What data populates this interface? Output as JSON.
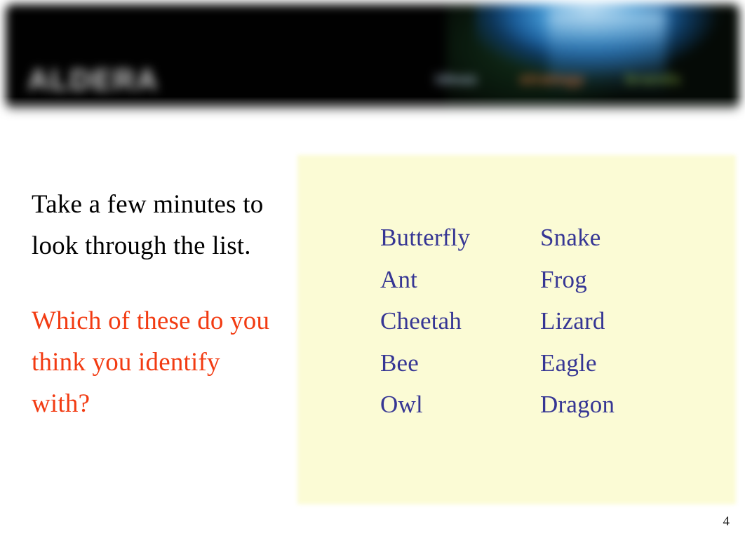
{
  "slide": {
    "page_number": "4",
    "background_color": "#ffffff"
  },
  "banner": {
    "logo_text": "ALDERA",
    "nav_words": [
      {
        "label": "ideas",
        "color": "#9fb3c6"
      },
      {
        "label": "strategy",
        "color": "#c4693c"
      },
      {
        "label": "brands",
        "color": "#6f9038"
      }
    ],
    "background_color": "#010101",
    "glow_color": "#3f93cf"
  },
  "left_column": {
    "instruction": "Take a few minutes to look through the list.",
    "instruction_color": "#000000",
    "question": "Which of these do you think you identify with?",
    "question_color": "#f23b12"
  },
  "list_panel": {
    "background_color": "#fbfbd5",
    "text_color": "#363694",
    "column_left": [
      "Butterfly",
      "Ant",
      "Cheetah",
      "Bee",
      "Owl"
    ],
    "column_right": [
      "Snake",
      "Frog",
      "Lizard",
      "Eagle",
      "Dragon"
    ]
  }
}
